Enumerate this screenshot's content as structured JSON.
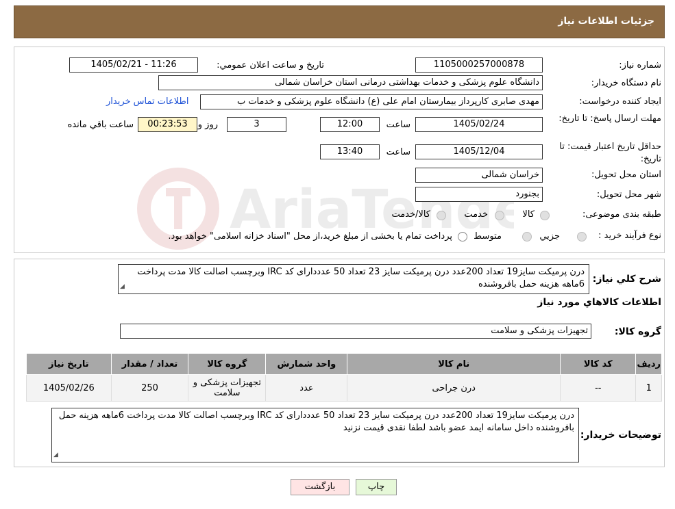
{
  "header": {
    "title": "جزئیات اطلاعات نیاز"
  },
  "watermark": {
    "text": "AriaTender.neT"
  },
  "form": {
    "need_number_label": "شماره نیاز:",
    "need_number": "1105000257000878",
    "announce_label": "تاریخ و ساعت اعلان عمومي:",
    "announce_value": "1405/02/21 - 11:26",
    "buyer_org_label": "نام دستگاه خريدار:",
    "buyer_org": "دانشگاه علوم پزشکی و خدمات بهداشتی درمانی استان خراسان شمالی",
    "requester_label": "ايجاد کننده درخواست:",
    "requester": "مهدی صابری کارپرداز بیمارستان امام علی (ع) دانشگاه علوم پزشکی و خدمات ب",
    "contact_link": "اطلاعات تماس خريدار",
    "deadline_label": "مهلت ارسال پاسخ: تا تاريخ:",
    "deadline_date": "1405/02/24",
    "time_label": "ساعت",
    "deadline_time": "12:00",
    "days_value": "3",
    "days_label": "روز و",
    "remaining_value": "00:23:53",
    "remaining_label": "ساعت باقي مانده",
    "validity_label": "حداقل تاريخ اعتبار قيمت: تا تاريخ:",
    "validity_date": "1405/12/04",
    "validity_time": "13:40",
    "province_label": "استان محل تحويل:",
    "province": "خراسان شمالی",
    "city_label": "شهر محل تحويل:",
    "city": "بجنورد",
    "category_label": "طبقه بندی موضوعی:",
    "category_options": [
      "کالا",
      "خدمت",
      "کالا/خدمت"
    ],
    "process_label": "نوع فرآيند خريد :",
    "process_options": [
      "جزيي",
      "متوسط"
    ],
    "process_note": "پرداخت تمام يا بخشی از مبلغ خريد،از محل \"اسناد خزانه اسلامی\" خواهد بود."
  },
  "summary": {
    "label": "شرح كلي نياز:",
    "text": "درن پرمیکت سایز19 تعداد 200عدد درن پرمیکت سایز 23 تعداد 50 عدددارای  کد IRC وبرچسب اصالت کالا مدت پرداخت 6ماهه هزینه حمل بافروشنده"
  },
  "goods": {
    "section_title": "اطلاعات كالاهاي مورد نياز",
    "group_label": "گروه کالا:",
    "group_value": "تجهیزات پزشکی و سلامت"
  },
  "table": {
    "headers": [
      "رديف",
      "کد کالا",
      "نام کالا",
      "واحد شمارش",
      "گروه کالا",
      "تعداد / مقدار",
      "تاريخ نياز"
    ],
    "rows": [
      [
        "1",
        "--",
        "درن جراحی",
        "عدد",
        "تجهیزات پزشکی و سلامت",
        "250",
        "1405/02/26"
      ]
    ]
  },
  "buyer_notes": {
    "label": "توضيحات خريدار:",
    "text": "درن پرمیکت سایز19 تعداد 200عدد درن پرمیکت سایز 23 تعداد 50 عدددارای  کد IRC وبرچسب اصالت کالا مدت پرداخت 6ماهه هزینه حمل بافروشنده داخل سامانه ایمد عضو باشد لطفا نقدی قیمت نزنید"
  },
  "buttons": {
    "print": "چاپ",
    "back": "بازگشت"
  },
  "colors": {
    "header_bg": "#8c6a43",
    "table_header": "#a8a8a8",
    "print_bg": "#e6f8d8",
    "back_bg": "#ffe4e4"
  }
}
